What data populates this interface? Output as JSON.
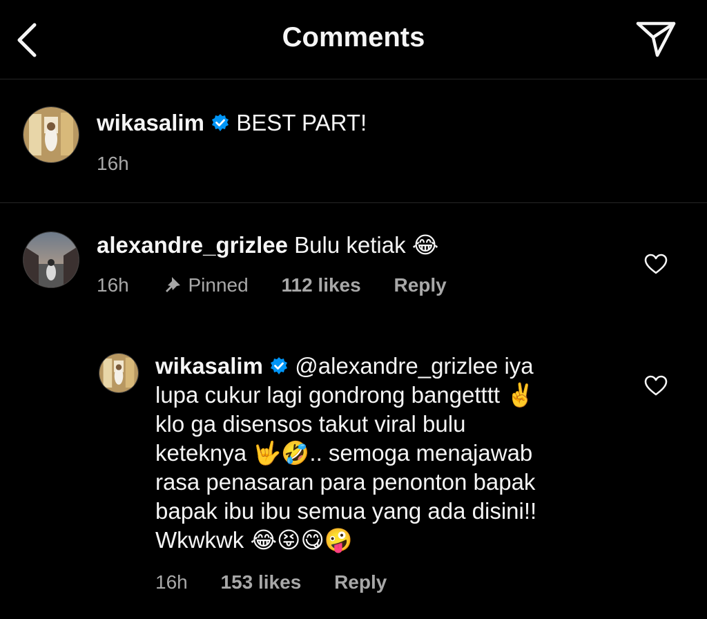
{
  "header": {
    "title": "Comments"
  },
  "comments": [
    {
      "username": "wikasalim",
      "verified": true,
      "text": "BEST PART!",
      "time": "16h"
    },
    {
      "username": "alexandre_grizlee",
      "text": "Bulu ketiak 😂",
      "time": "16h",
      "pinned_label": "Pinned",
      "likes": "112 likes",
      "reply_label": "Reply"
    }
  ],
  "reply": {
    "username": "wikasalim",
    "verified": true,
    "lines": [
      "@alexandre_grizlee iya",
      "lupa cukur lagi gondrong bangetttt ✌️",
      "klo ga disensos takut viral bulu",
      "keteknya 🤟🤣.. semoga menajawab",
      "rasa penasaran para penonton bapak",
      "bapak ibu ibu semua yang ada disini!!",
      "Wkwkwk 😂😝😋🤪"
    ],
    "time": "16h",
    "likes": "153 likes",
    "reply_label": "Reply"
  },
  "icons": {
    "back": "chevron-left-icon",
    "send": "paper-plane-icon",
    "verified": "verified-badge-icon",
    "pin": "pin-icon",
    "heart": "heart-outline-icon"
  },
  "colors": {
    "background": "#000000",
    "text": "#f5f5f5",
    "secondary_text": "#a8a8a8",
    "verified_blue": "#0095f6"
  }
}
